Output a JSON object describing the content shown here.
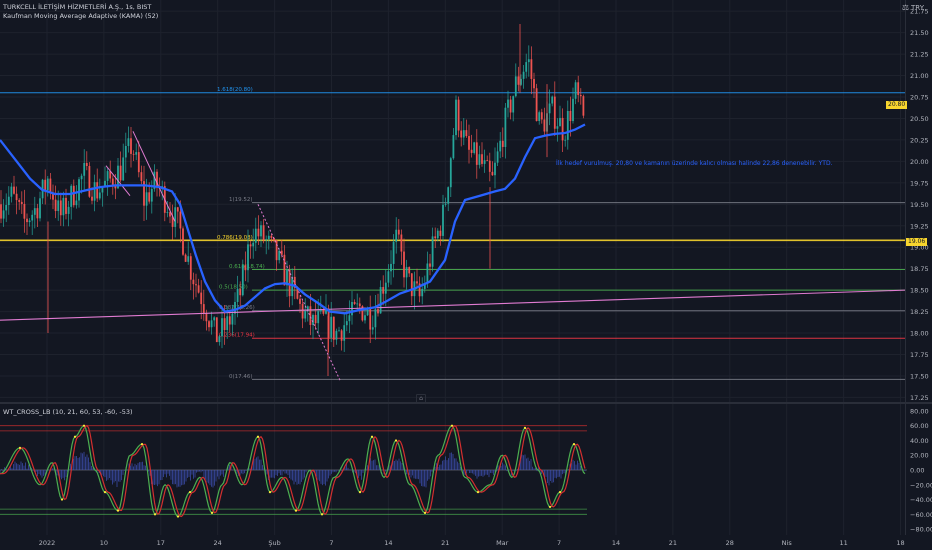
{
  "header": {
    "symbol": "TURKCELL İLETİŞİM HİZMETLERİ A.Ş., 1s, BIST",
    "indicator": "Kaufman Moving Average Adaptive (KAMA) (52)",
    "currency": "TRY"
  },
  "subpanel": {
    "title": "WT_CROSS_LB (10, 21, 60, 53, -60, -53)"
  },
  "colors": {
    "background": "#131722",
    "grid": "#1e222d",
    "up": "#26a69a",
    "down": "#ef5350",
    "kama": "#2962ff",
    "hline_yellow": "#f7d52e",
    "trendline": "#e07bd1",
    "wave_red": "#d32f2f",
    "wave_green": "#4caf50",
    "hist": "#3f51b5",
    "fib_gray": "#787b86",
    "fib_red": "#f23645",
    "fib_green": "#4caf50",
    "fib_blue": "#2196f3"
  },
  "chart_data": [
    {
      "type": "candlestick",
      "y_axis": {
        "range": [
          17.25,
          21.85
        ],
        "ticks": [
          17.25,
          17.5,
          17.75,
          18.0,
          18.25,
          18.5,
          18.75,
          19.0,
          19.25,
          19.5,
          19.75,
          20.0,
          20.25,
          20.5,
          20.75,
          21.0,
          21.25,
          21.5,
          21.75
        ]
      },
      "x_axis": {
        "labels": [
          "2022",
          "10",
          "17",
          "24",
          "Şub",
          "7",
          "14",
          "21",
          "Mar",
          "7",
          "14",
          "21",
          "28",
          "Nis",
          "11",
          "18"
        ]
      },
      "price_badges": [
        "20.80",
        "19.06"
      ],
      "fib_levels": [
        {
          "label": "1.618(20.80)",
          "value": 20.8,
          "color": "#2196f3"
        },
        {
          "label": "1(19.52)",
          "value": 19.52,
          "color": "#787b86"
        },
        {
          "label": "0.786(19.08)",
          "value": 19.08,
          "color": "#f7d52e"
        },
        {
          "label": "0.618(18.74)",
          "value": 18.74,
          "color": "#4caf50"
        },
        {
          "label": "0.5(18.50)",
          "value": 18.5,
          "color": "#4caf50"
        },
        {
          "label": "0.382(18.26)",
          "value": 18.26,
          "color": "#787b86"
        },
        {
          "label": "0.236(17.94)",
          "value": 17.94,
          "color": "#f23645"
        },
        {
          "label": "0(17.46)",
          "value": 17.46,
          "color": "#787b86"
        }
      ],
      "annotation": "İlk hedef vurulmuş. 20,80 ve kamanın üzerinde kalıcı olması halinde 22,86 denenebilir. YTD.",
      "kama_path": [
        [
          0,
          20.25
        ],
        [
          10,
          20.1
        ],
        [
          20,
          19.95
        ],
        [
          30,
          19.8
        ],
        [
          42,
          19.67
        ],
        [
          55,
          19.62
        ],
        [
          70,
          19.62
        ],
        [
          85,
          19.66
        ],
        [
          100,
          19.7
        ],
        [
          115,
          19.72
        ],
        [
          130,
          19.72
        ],
        [
          145,
          19.72
        ],
        [
          160,
          19.7
        ],
        [
          172,
          19.65
        ],
        [
          180,
          19.5
        ],
        [
          188,
          19.2
        ],
        [
          196,
          18.9
        ],
        [
          205,
          18.6
        ],
        [
          215,
          18.38
        ],
        [
          225,
          18.25
        ],
        [
          235,
          18.27
        ],
        [
          245,
          18.32
        ],
        [
          255,
          18.42
        ],
        [
          265,
          18.52
        ],
        [
          275,
          18.57
        ],
        [
          285,
          18.58
        ],
        [
          295,
          18.55
        ],
        [
          305,
          18.45
        ],
        [
          318,
          18.35
        ],
        [
          330,
          18.25
        ],
        [
          345,
          18.23
        ],
        [
          360,
          18.27
        ],
        [
          375,
          18.3
        ],
        [
          388,
          18.38
        ],
        [
          400,
          18.46
        ],
        [
          415,
          18.52
        ],
        [
          430,
          18.6
        ],
        [
          445,
          18.85
        ],
        [
          455,
          19.3
        ],
        [
          465,
          19.55
        ],
        [
          480,
          19.6
        ],
        [
          495,
          19.65
        ],
        [
          505,
          19.68
        ],
        [
          515,
          19.8
        ],
        [
          525,
          20.05
        ],
        [
          535,
          20.27
        ],
        [
          545,
          20.3
        ],
        [
          555,
          20.32
        ],
        [
          565,
          20.33
        ],
        [
          575,
          20.37
        ],
        [
          585,
          20.43
        ]
      ],
      "trendline": [
        [
          0,
          18.15
        ],
        [
          905,
          18.5
        ]
      ],
      "downtrend_lines": [
        [
          [
            106,
            19.95
          ],
          [
            130,
            19.6
          ]
        ],
        [
          [
            133,
            20.35
          ],
          [
            175,
            19.3
          ]
        ],
        [
          [
            258,
            19.5
          ],
          [
            340,
            17.45
          ]
        ]
      ],
      "candle_anchors": [
        [
          0,
          19.5
        ],
        [
          12,
          19.6
        ],
        [
          24,
          19.3
        ],
        [
          36,
          19.45
        ],
        [
          48,
          19.8
        ],
        [
          60,
          19.35
        ],
        [
          72,
          19.6
        ],
        [
          84,
          19.85
        ],
        [
          96,
          19.65
        ],
        [
          108,
          19.75
        ],
        [
          120,
          19.9
        ],
        [
          132,
          20.2
        ],
        [
          144,
          19.55
        ],
        [
          156,
          19.75
        ],
        [
          168,
          19.5
        ],
        [
          180,
          19.2
        ],
        [
          192,
          18.7
        ],
        [
          204,
          18.35
        ],
        [
          216,
          17.95
        ],
        [
          228,
          18.1
        ],
        [
          240,
          18.45
        ],
        [
          252,
          19.2
        ],
        [
          264,
          19.1
        ],
        [
          276,
          18.9
        ],
        [
          288,
          18.6
        ],
        [
          300,
          18.3
        ],
        [
          312,
          18.1
        ],
        [
          324,
          18.15
        ],
        [
          336,
          18.0
        ],
        [
          348,
          18.15
        ],
        [
          360,
          18.3
        ],
        [
          372,
          18.2
        ],
        [
          384,
          18.6
        ],
        [
          396,
          19.1
        ],
        [
          408,
          18.6
        ],
        [
          420,
          18.4
        ],
        [
          432,
          18.95
        ],
        [
          444,
          19.4
        ],
        [
          456,
          20.6
        ],
        [
          468,
          20.1
        ],
        [
          480,
          20.0
        ],
        [
          492,
          19.75
        ],
        [
          504,
          20.4
        ],
        [
          516,
          20.9
        ],
        [
          528,
          21.2
        ],
        [
          540,
          20.4
        ],
        [
          552,
          20.6
        ],
        [
          564,
          20.35
        ],
        [
          576,
          20.8
        ],
        [
          584,
          20.45
        ]
      ]
    },
    {
      "type": "line",
      "y_axis": {
        "range": [
          -85,
          85
        ],
        "ticks": [
          80,
          60,
          40,
          20,
          0,
          -20,
          -40,
          -60,
          -80
        ]
      },
      "levels": [
        60,
        53,
        0,
        -53,
        -60
      ],
      "wave_anchors": [
        [
          0,
          -5
        ],
        [
          20,
          30
        ],
        [
          40,
          -20
        ],
        [
          52,
          10
        ],
        [
          62,
          -40
        ],
        [
          75,
          45
        ],
        [
          84,
          60
        ],
        [
          95,
          0
        ],
        [
          105,
          -30
        ],
        [
          118,
          -55
        ],
        [
          130,
          20
        ],
        [
          142,
          35
        ],
        [
          155,
          -60
        ],
        [
          165,
          -20
        ],
        [
          178,
          -63
        ],
        [
          190,
          -30
        ],
        [
          200,
          -10
        ],
        [
          212,
          -58
        ],
        [
          222,
          -20
        ],
        [
          230,
          10
        ],
        [
          242,
          -20
        ],
        [
          258,
          45
        ],
        [
          270,
          -30
        ],
        [
          282,
          -10
        ],
        [
          296,
          -55
        ],
        [
          310,
          0
        ],
        [
          322,
          -60
        ],
        [
          334,
          -10
        ],
        [
          348,
          15
        ],
        [
          360,
          -30
        ],
        [
          372,
          45
        ],
        [
          384,
          -10
        ],
        [
          396,
          40
        ],
        [
          410,
          -20
        ],
        [
          425,
          -58
        ],
        [
          438,
          20
        ],
        [
          452,
          60
        ],
        [
          465,
          -10
        ],
        [
          478,
          -30
        ],
        [
          490,
          -20
        ],
        [
          502,
          20
        ],
        [
          512,
          -10
        ],
        [
          525,
          57
        ],
        [
          538,
          0
        ],
        [
          550,
          -50
        ],
        [
          560,
          -30
        ],
        [
          574,
          35
        ],
        [
          585,
          -5
        ]
      ]
    }
  ]
}
